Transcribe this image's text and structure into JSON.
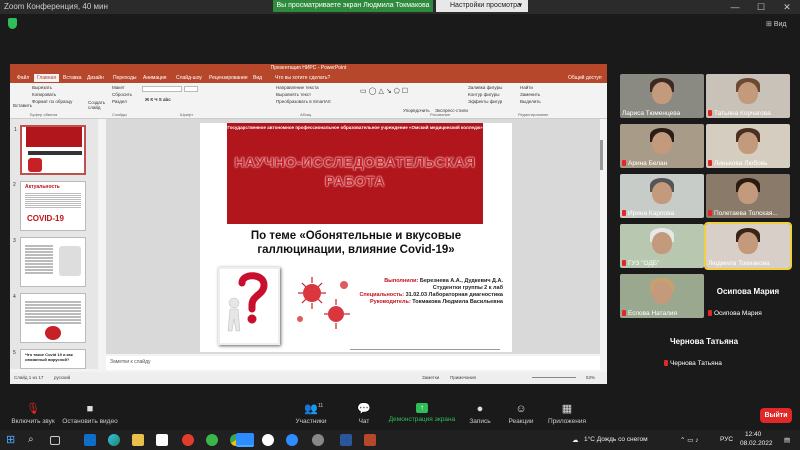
{
  "window": {
    "title": "Zoom Конференция, 40 мин",
    "share_banner": "Вы просматриваете экран Людмила Токмакова",
    "view_options": "Настройки просмотра",
    "view_label": "Вид",
    "minimize": "—",
    "maximize": "☐",
    "close": "✕"
  },
  "powerpoint": {
    "file_title": "Презентация НИРС - PowerPoint",
    "tabs": [
      "Файл",
      "Главная",
      "Вставка",
      "Дизайн",
      "Переходы",
      "Анимация",
      "Слайд-шоу",
      "Рецензирование",
      "Вид"
    ],
    "active_tab": "Главная",
    "search": "Что вы хотите сделать?",
    "share": "Общий доступ",
    "ribbon": {
      "paste": "Вставить",
      "cut": "Вырезать",
      "copy": "Копировать",
      "format_painter": "Формат по образцу",
      "new_slide": "Создать слайд",
      "layout": "Макет",
      "reset": "Сбросить",
      "section": "Раздел",
      "text_direction": "Направление текста",
      "align_text": "Выровнять текст",
      "smartart": "Преобразовать в SmartArt",
      "arrange": "Упорядочить",
      "quick_styles": "Экспресс-стили",
      "shape_fill": "Заливка фигуры",
      "shape_outline": "Контур фигуры",
      "shape_effects": "Эффекты фигур",
      "find": "Найти",
      "replace": "Заменить",
      "select": "Выделить",
      "groups": [
        "Буфер обмена",
        "Слайды",
        "Шрифт",
        "Абзац",
        "Рисование",
        "Редактирование"
      ]
    },
    "thumbnail_numbers": [
      "1",
      "2",
      "3",
      "4",
      "5"
    ],
    "thumb2_word": "Актуальность",
    "thumb2_title": "COVID-19",
    "thumb5_text": "Что такое Covid 19 и как связанный вирусной?",
    "notes_placeholder": "Заметки к слайду",
    "status": {
      "slide": "Слайд 1 из 17",
      "lang": "русский",
      "notes": "Заметки",
      "comments": "Примечания",
      "zoom": "53%"
    }
  },
  "slide": {
    "org": "Государственное автономное профессиональное образовательное учреждение «Омский медицинский колледж»",
    "title": "НАУЧНО-ИССЛЕДОВАТЕЛЬСКАЯ РАБОТА",
    "topic": "По теме «Обонятельные и вкусовые галлюцинации, влияние Covid-19»",
    "authors_label": "Выполнили:",
    "authors": "Березнева А.А., Дудкевич Д.А.",
    "group": "Студентки группы 2 к лаб",
    "spec_label": "Специальность:",
    "spec": "31.02.03 Лабораторная диагностика",
    "lead_label": "Руководитель:",
    "lead": "Токмакова Людмила Васильевна"
  },
  "participants": [
    {
      "name": "Лариса Тюменцева",
      "muted": false,
      "video": true
    },
    {
      "name": "Татьяна Корчагова",
      "muted": true,
      "video": true
    },
    {
      "name": "Арина Белан",
      "muted": true,
      "video": true
    },
    {
      "name": "Линькова Любовь",
      "muted": true,
      "video": true
    },
    {
      "name": "Ирина Карпова",
      "muted": true,
      "video": true
    },
    {
      "name": "Полетаева Толская...",
      "muted": true,
      "video": true
    },
    {
      "name": "ГУЗ \"ОДБ\"",
      "muted": true,
      "video": true
    },
    {
      "name": "Людмила Токмакова",
      "muted": false,
      "video": true,
      "speaking": true
    },
    {
      "name": "Еспова Наталия",
      "muted": true,
      "video": true
    },
    {
      "name": "Осипова Мария",
      "muted": true,
      "video": false,
      "big": "Осипова Мария"
    },
    {
      "name": "Чернова Татьяна",
      "muted": true,
      "video": false,
      "big": "Чернова Татьяна"
    }
  ],
  "toolbar": {
    "mute": "Включить звук",
    "video": "Остановить видео",
    "participants": "Участники",
    "participants_count": "11",
    "chat": "Чат",
    "share": "Демонстрация экрана",
    "record": "Запись",
    "reactions": "Реакции",
    "apps": "Приложения",
    "apps_count": "1",
    "leave": "Выйти"
  },
  "taskbar": {
    "weather": "1°С Дождь со снегом",
    "lang": "РУС",
    "time": "12:40",
    "date": "08.02.2022"
  },
  "colors": {
    "ppt_accent": "#b7472a",
    "slide_red": "#b0161c",
    "zoom_green": "#2ebd59",
    "leave_red": "#e02828",
    "speaking": "#f0d040"
  }
}
